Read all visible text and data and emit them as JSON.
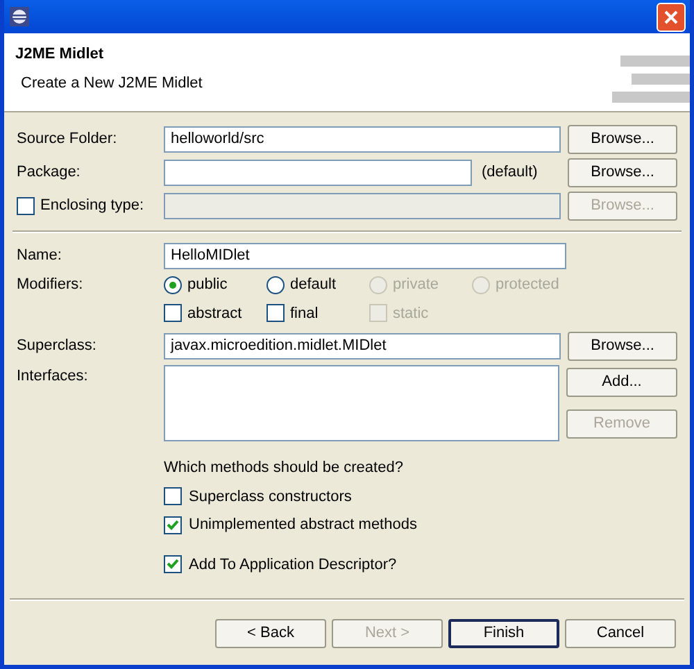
{
  "header": {
    "title": "J2ME Midlet",
    "description": "Create a New J2ME Midlet"
  },
  "source_folder": {
    "label": "Source Folder:",
    "value": "helloworld/src",
    "button": {
      "label": "Browse...",
      "disabled": false
    }
  },
  "package": {
    "label": "Package:",
    "suffix": "(default)",
    "button": {
      "label": "Browse...",
      "disabled": false
    }
  },
  "enclosing_type": {
    "label": "Enclosing type:",
    "checked": false,
    "disabled": true,
    "button": {
      "label": "Browse...",
      "disabled": true
    }
  },
  "name": {
    "label": "Name:",
    "value": "HelloMIDlet"
  },
  "modifiers": {
    "label": "Modifiers:",
    "access": [
      {
        "label": "public",
        "selected": true,
        "disabled": false
      },
      {
        "label": "default",
        "selected": false,
        "disabled": false
      },
      {
        "label": "private",
        "selected": false,
        "disabled": true
      },
      {
        "label": "protected",
        "selected": false,
        "disabled": true
      }
    ],
    "flags": [
      {
        "label": "abstract",
        "checked": false,
        "disabled": false
      },
      {
        "label": "final",
        "checked": false,
        "disabled": false
      },
      {
        "label": "static",
        "checked": false,
        "disabled": true
      }
    ]
  },
  "superclass": {
    "label": "Superclass:",
    "value": "javax.microedition.midlet.MIDlet",
    "button": {
      "label": "Browse...",
      "disabled": false
    }
  },
  "interfaces": {
    "label": "Interfaces:",
    "buttons": [
      {
        "label": "Add...",
        "disabled": false
      },
      {
        "label": "Remove",
        "disabled": true
      }
    ]
  },
  "methods": {
    "question": "Which methods should be created?",
    "options": [
      {
        "label": "Superclass constructors",
        "checked": false
      },
      {
        "label": "Unimplemented abstract methods",
        "checked": true
      }
    ]
  },
  "descriptor": {
    "label": "Add To Application Descriptor?",
    "checked": true
  },
  "buttons": [
    {
      "label": "< Back",
      "disabled": false,
      "default": false
    },
    {
      "label": "Next >",
      "disabled": true,
      "default": false
    },
    {
      "label": "Finish",
      "disabled": false,
      "default": true
    },
    {
      "label": "Cancel",
      "disabled": false,
      "default": false
    }
  ]
}
